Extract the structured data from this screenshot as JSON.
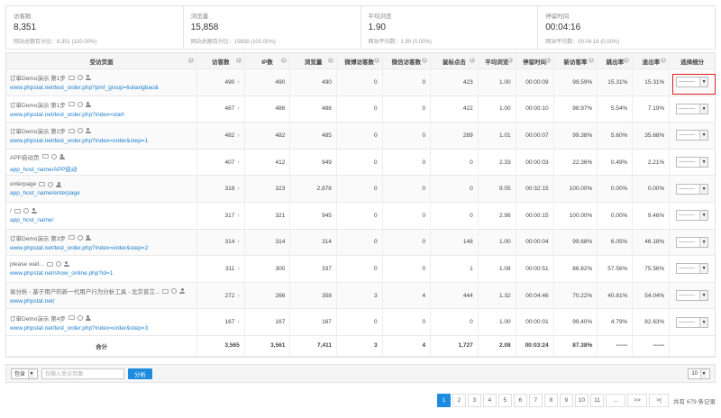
{
  "summary": [
    {
      "label": "访客数",
      "value": "8,351",
      "sub": "网站总额百分比：8,351 (100.00%)"
    },
    {
      "label": "浏览量",
      "value": "15,858",
      "sub": "网站总额百分比：15858 (100.00%)"
    },
    {
      "label": "平均浏览",
      "value": "1.90",
      "sub": "网站平均数：1.90 (0.00%)"
    },
    {
      "label": "停留时间",
      "value": "00:04:16",
      "sub": "网站平均数：00:04:16 (0.00%)"
    }
  ],
  "columns": [
    "受访页面",
    "访客数",
    "IP数",
    "浏览量",
    "微博访客数",
    "微信访客数",
    "鼠标点击",
    "平均浏览",
    "停留时间",
    "新访客率",
    "跳出率",
    "退出率",
    "选择细分"
  ],
  "rows": [
    {
      "name": "订单Demo演示 第1步",
      "url": "www.phpstat.net/test_order.php?pmf_group=liuliangbao&",
      "c": [
        "490",
        "490",
        "490",
        "0",
        "0",
        "423",
        "1.00",
        "00:00:09",
        "99.59%",
        "15.31%",
        "15.31%"
      ]
    },
    {
      "name": "订单Demo演示 第1步",
      "url": "www.phpstat.net/test_order.php?index=start",
      "c": [
        "487",
        "486",
        "488",
        "0",
        "0",
        "422",
        "1.00",
        "00:00:10",
        "98.97%",
        "5.54%",
        "7.19%"
      ]
    },
    {
      "name": "订单Demo演示 第2步",
      "url": "www.phpstat.net/test_order.php?index=order&step=1",
      "c": [
        "482",
        "482",
        "485",
        "0",
        "0",
        "289",
        "1.01",
        "00:00:07",
        "99.38%",
        "5.60%",
        "35.68%"
      ]
    },
    {
      "name": "APP启动页",
      "url": "app_host_name/APP启动",
      "c": [
        "407",
        "412",
        "949",
        "0",
        "0",
        "0",
        "2.33",
        "00:00:03",
        "22.36%",
        "0.49%",
        "2.21%"
      ]
    },
    {
      "name": "enterpage",
      "url": "app_host_name/enterpage",
      "c": [
        "318",
        "323",
        "2,878",
        "0",
        "0",
        "0",
        "9.05",
        "00:32:15",
        "100.00%",
        "0.00%",
        "0.00%"
      ]
    },
    {
      "name": "/",
      "url": "app_host_name/",
      "c": [
        "317",
        "321",
        "945",
        "0",
        "0",
        "0",
        "2.98",
        "00:00:15",
        "100.00%",
        "0.00%",
        "9.46%"
      ]
    },
    {
      "name": "订单Demo演示 第3步",
      "url": "www.phpstat.net/test_order.php?index=order&step=2",
      "c": [
        "314",
        "314",
        "314",
        "0",
        "0",
        "148",
        "1.00",
        "00:00:04",
        "99.68%",
        "6.05%",
        "46.18%"
      ]
    },
    {
      "name": "please wait...",
      "url": "www.phpstat.net/show_online.php?id=1",
      "c": [
        "311",
        "300",
        "337",
        "0",
        "0",
        "1",
        "1.08",
        "00:00:51",
        "86.82%",
        "57.56%",
        "75.56%"
      ]
    },
    {
      "name": "易分析 - 基于用户的新一代用户行为分析工具 - 北京普艾...",
      "url": "www.phpstat.net/",
      "c": [
        "272",
        "266",
        "358",
        "3",
        "4",
        "444",
        "1.32",
        "00:04:46",
        "70.22%",
        "40.81%",
        "54.04%"
      ]
    },
    {
      "name": "订单Demo演示 第4步",
      "url": "www.phpstat.net/test_order.php?index=order&step=3",
      "c": [
        "167",
        "167",
        "167",
        "0",
        "0",
        "0",
        "1.00",
        "00:00:01",
        "99.40%",
        "4.79%",
        "82.63%"
      ]
    }
  ],
  "segment_placeholder": "---------",
  "total": {
    "label": "合计",
    "c": [
      "3,565",
      "3,561",
      "7,411",
      "3",
      "4",
      "1,727",
      "2.08",
      "00:03:24",
      "87.38%",
      "------",
      "------"
    ]
  },
  "filter": {
    "mode": "包含",
    "placeholder": "仅输入受访页面",
    "button": "分析",
    "page_size": "10"
  },
  "pagination": {
    "pages": [
      "1",
      "2",
      "3",
      "4",
      "5",
      "6",
      "7",
      "8",
      "9",
      "10",
      "11",
      "...",
      ">>",
      ">|"
    ],
    "active": "1",
    "total_text": "共有 679 条记录"
  }
}
